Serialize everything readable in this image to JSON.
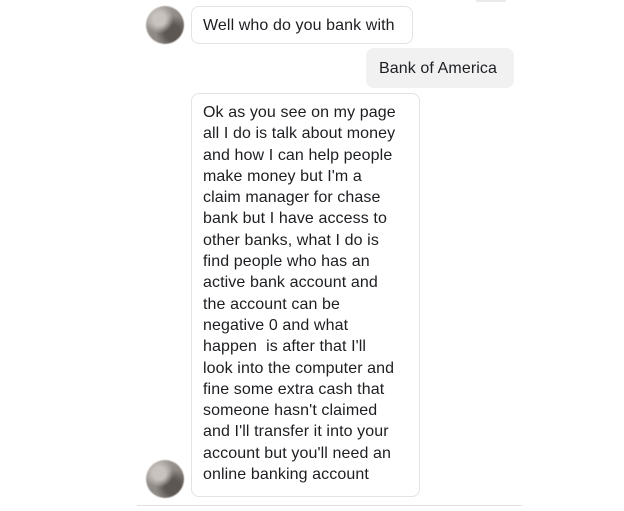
{
  "conversation": {
    "messages": [
      {
        "sender": "other",
        "text": "Well who do you bank with"
      },
      {
        "sender": "me",
        "text": "Bank of America"
      },
      {
        "sender": "other",
        "lines": [
          "Ok as you see on my page",
          "all I do is talk about money",
          "and how I can help people",
          "make money but I'm a",
          "claim manager for chase",
          "bank but I have access to",
          "other banks, what I do is",
          "find people who has an",
          "active bank account and",
          "the account can be",
          "negative 0 and what",
          "happen  is after that I'll",
          "look into the computer and",
          "fine some extra cash that",
          "someone hasn't claimed",
          "and I'll transfer it into your",
          "account but you'll need an",
          "online banking account"
        ]
      }
    ]
  }
}
